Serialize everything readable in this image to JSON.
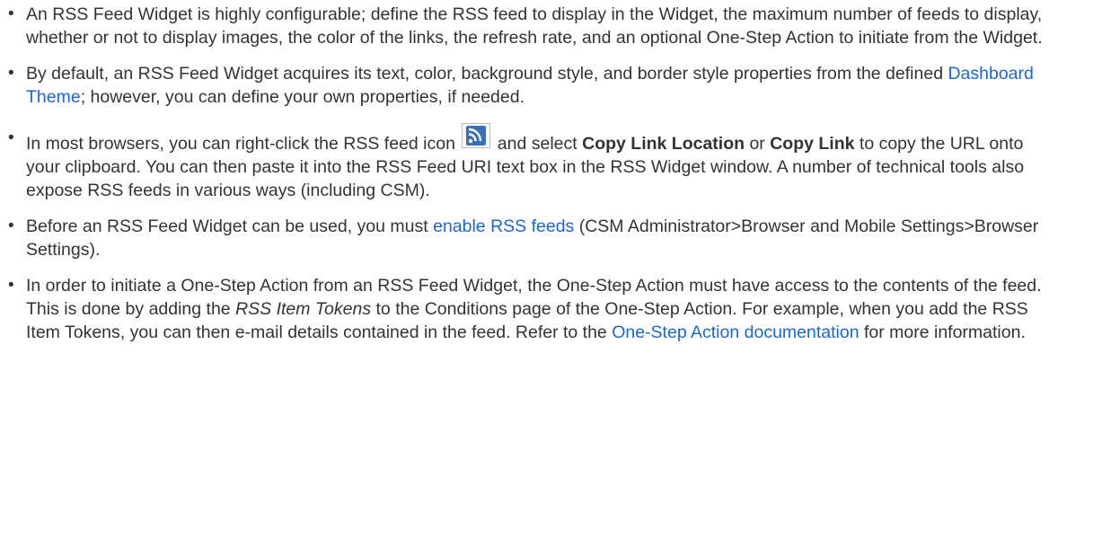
{
  "bullets": [
    {
      "text": "An RSS Feed Widget is highly configurable; define the RSS feed to display in the Widget, the maximum number of feeds to display, whether or not to display images, the color of the links, the refresh rate, and an optional One-Step Action to initiate from the Widget."
    },
    {
      "before": "By default, an RSS Feed Widget acquires its text, color, background style, and border style properties from the defined ",
      "link": "Dashboard Theme",
      "after": "; however, you can define your own properties, if needed."
    },
    {
      "before_icon": "In most browsers, you can right-click the RSS feed icon",
      "icon": "rss-feed-icon",
      "mid1": " and select ",
      "bold1": "Copy Link Location",
      "mid2": " or ",
      "bold2": "Copy Link",
      "after": " to copy the URL onto your clipboard. You can then paste it into the RSS Feed URI text box in the RSS Widget window. A number of technical tools also expose RSS feeds in various ways (including CSM)."
    },
    {
      "before": "Before an RSS Feed Widget can be used, you must ",
      "link": "enable RSS feeds",
      "after": " (CSM Administrator>Browser and Mobile Settings>Browser Settings)."
    },
    {
      "before": "In order to initiate a One-Step Action from an RSS Feed Widget, the One-Step Action must have access to the contents of the feed. This is done by adding the ",
      "italic": "RSS Item Tokens",
      "mid": " to the Conditions page of the One-Step Action. For example, when you add the RSS Item Tokens, you can then e-mail details contained in the feed. Refer to the ",
      "link": "One-Step Action documentation",
      "after": " for more information."
    }
  ],
  "bullet_char": "•",
  "colors": {
    "text": "#333333",
    "link": "#1a66d6",
    "rss_icon_bg": "#3b6fb6"
  }
}
